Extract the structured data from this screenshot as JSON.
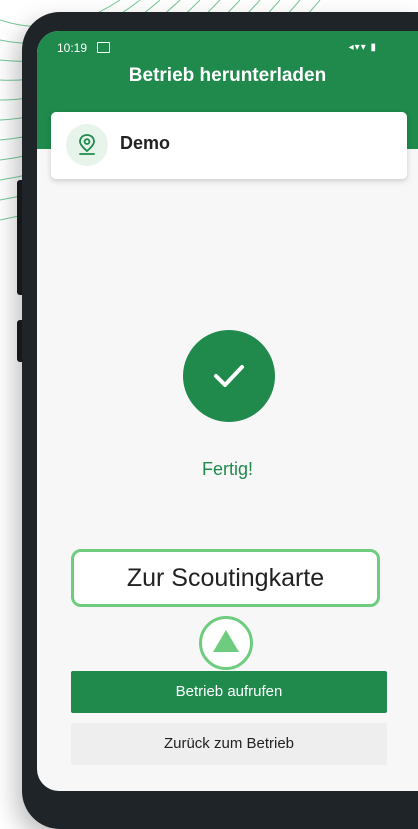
{
  "status_bar": {
    "time": "10:19",
    "icons": "◂▾▾ ▮"
  },
  "header": {
    "title": "Betrieb herunterladen"
  },
  "farm_card": {
    "name": "Demo",
    "icon": "location-pin-icon"
  },
  "download": {
    "status_text": "Fertig!",
    "icon": "checkmark-icon"
  },
  "tooltip": {
    "text": "Zur Scoutingkarte"
  },
  "actions": {
    "primary_label": "Betrieb aufrufen",
    "secondary_label": "Zurück zum Betrieb"
  },
  "colors": {
    "brand_green": "#1f8a4c",
    "highlight_green": "#6dcc7d"
  }
}
